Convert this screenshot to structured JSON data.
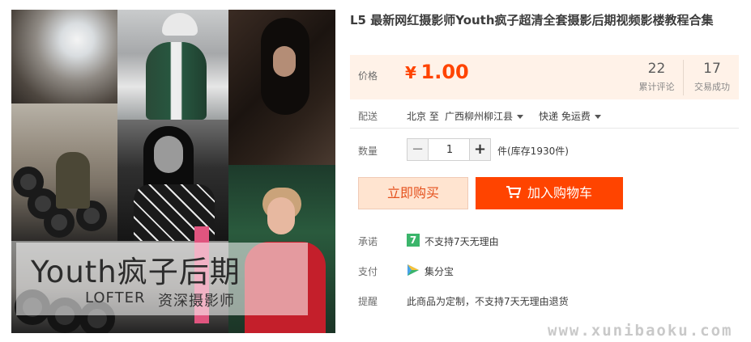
{
  "product": {
    "title": "L5 最新网红摄影师Youth疯子超清全套摄影后期视频影楼教程合集",
    "image_overlay": {
      "title": "Youth疯子后期",
      "sub_left": "LOFTER",
      "sub_right": "资深摄影师"
    }
  },
  "price": {
    "label": "价格",
    "currency": "¥",
    "value": "1.00",
    "color": "#ff4400"
  },
  "stats": [
    {
      "count": "22",
      "label": "累计评论"
    },
    {
      "count": "17",
      "label": "交易成功"
    }
  ],
  "shipping": {
    "label": "配送",
    "from": "北京 至",
    "to": "广西柳州柳江县",
    "method": "快递 免运费"
  },
  "quantity": {
    "label": "数量",
    "value": "1",
    "minus": "−",
    "plus": "+",
    "stock": "件(库存1930件)"
  },
  "actions": {
    "buy_now": "立即购买",
    "add_to_cart": "加入购物车"
  },
  "promise": {
    "label": "承诺",
    "badge": "7",
    "text": "不支持7天无理由"
  },
  "payment": {
    "label": "支付",
    "method": "集分宝"
  },
  "reminder": {
    "label": "提醒",
    "text": "此商品为定制，不支持7天无理由退货"
  },
  "watermark": "www.xunibaoku.com",
  "icons": {
    "cart": "cart-icon",
    "payment": "jifenbao-icon"
  }
}
